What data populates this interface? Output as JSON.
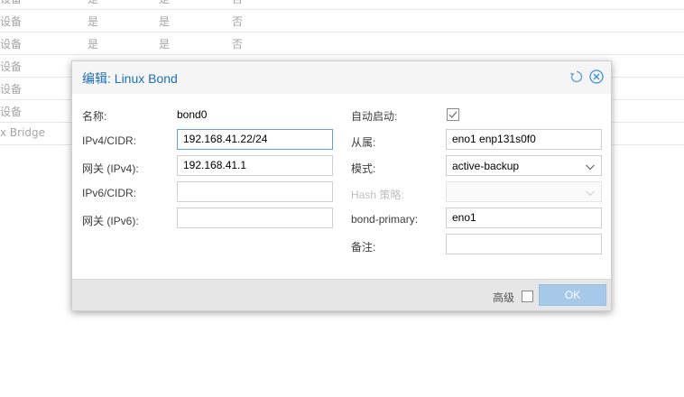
{
  "background_table": {
    "rows": [
      {
        "type": "设备",
        "active": "是",
        "autostart": "是",
        "vlan": "否"
      },
      {
        "type": "设备",
        "active": "是",
        "autostart": "是",
        "vlan": "否"
      },
      {
        "type": "设备",
        "active": "",
        "autostart": "",
        "vlan": ""
      },
      {
        "type": "设备",
        "active": "",
        "autostart": "",
        "vlan": ""
      },
      {
        "type": "设备",
        "active": "",
        "autostart": "",
        "vlan": ""
      },
      {
        "type": "x Bridge",
        "active": "",
        "autostart": "",
        "vlan": ""
      }
    ]
  },
  "dialog": {
    "title": "编辑: Linux Bond",
    "icons": {
      "reset": "reset-icon",
      "close": "close-icon"
    },
    "left_fields": {
      "name": {
        "label": "名称:",
        "value": "bond0"
      },
      "ipv4_cidr": {
        "label": "IPv4/CIDR:",
        "value": "192.168.41.22/24"
      },
      "gateway_ipv4": {
        "label": "网关 (IPv4):",
        "value": "192.168.41.1"
      },
      "ipv6_cidr": {
        "label": "IPv6/CIDR:",
        "value": ""
      },
      "gateway_ipv6": {
        "label": "网关 (IPv6):",
        "value": ""
      }
    },
    "right_fields": {
      "autostart": {
        "label": "自动启动:",
        "checked": true
      },
      "slaves": {
        "label": "从属:",
        "value": "eno1 enp131s0f0"
      },
      "mode": {
        "label": "模式:",
        "value": "active-backup"
      },
      "hash_policy": {
        "label": "Hash 策略:",
        "value": ""
      },
      "bond_primary": {
        "label": "bond-primary:",
        "value": "eno1"
      },
      "comment": {
        "label": "备注:",
        "value": ""
      }
    },
    "footer": {
      "advanced_label": "高级",
      "advanced_checked": false,
      "ok_label": "OK"
    }
  },
  "colors": {
    "title_blue": "#1d6fb2",
    "ok_button_disabled": "#a6c9ea",
    "focus_border": "#5fa2dd"
  }
}
